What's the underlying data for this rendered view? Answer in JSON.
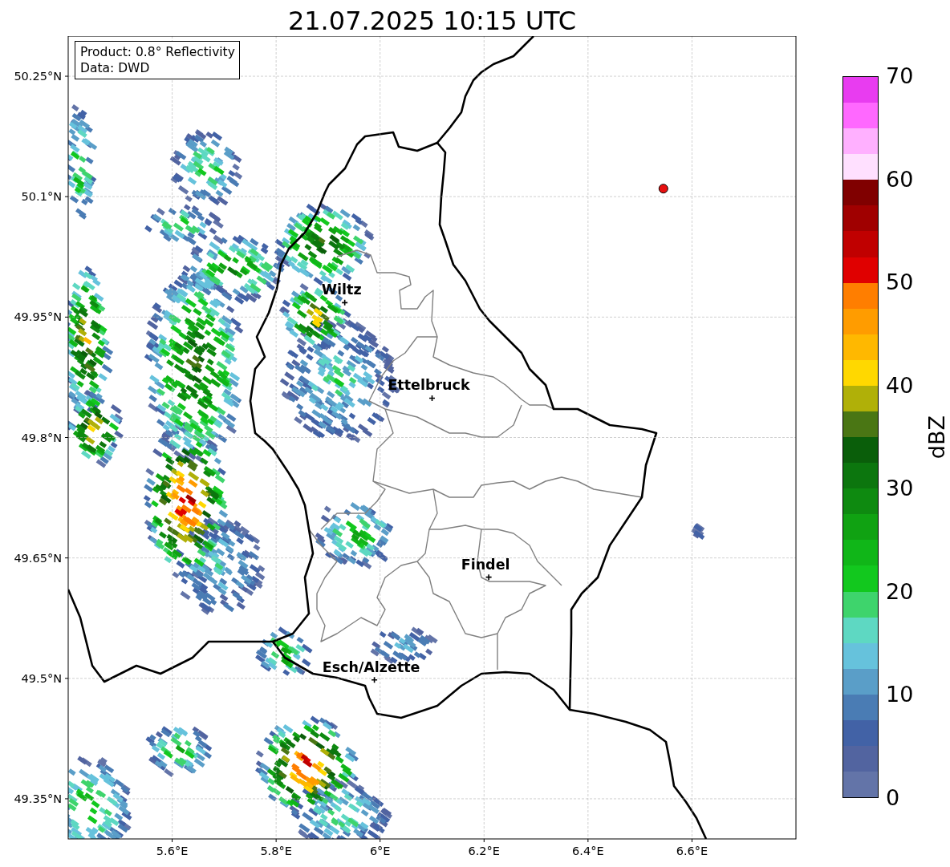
{
  "title": "21.07.2025 10:15 UTC",
  "info_box": [
    "Product: 0.8° Reflectivity",
    "Data: DWD"
  ],
  "map": {
    "chart_data": {
      "type": "scatter",
      "xlim": [
        5.4,
        6.8
      ],
      "ylim": [
        49.3,
        50.3
      ],
      "grid": true,
      "xticks": [
        {
          "value": 5.6,
          "label": "5.6°E"
        },
        {
          "value": 5.8,
          "label": "5.8°E"
        },
        {
          "value": 6.0,
          "label": "6°E"
        },
        {
          "value": 6.2,
          "label": "6.2°E"
        },
        {
          "value": 6.4,
          "label": "6.4°E"
        },
        {
          "value": 6.6,
          "label": "6.6°E"
        }
      ],
      "yticks": [
        {
          "value": 50.25,
          "label": "50.25°N"
        },
        {
          "value": 50.1,
          "label": "50.1°N"
        },
        {
          "value": 49.95,
          "label": "49.95°N"
        },
        {
          "value": 49.8,
          "label": "49.8°N"
        },
        {
          "value": 49.65,
          "label": "49.65°N"
        },
        {
          "value": 49.5,
          "label": "49.5°N"
        },
        {
          "value": 49.35,
          "label": "49.35°N"
        }
      ],
      "series": [
        {
          "color": "#000000",
          "x": [
            5.932,
            6.1,
            6.209,
            5.989
          ],
          "values": [
            49.968,
            49.849,
            49.626,
            49.498
          ]
        },
        {
          "color": "#e81010",
          "x": [
            6.545
          ],
          "values": [
            50.11
          ]
        }
      ],
      "annotations": [
        {
          "x": 5.932,
          "y": 49.968,
          "text": "Wiltz"
        },
        {
          "x": 6.1,
          "y": 49.849,
          "text": "Ettelbruck"
        },
        {
          "x": 6.209,
          "y": 49.626,
          "text": "Findel"
        },
        {
          "x": 5.989,
          "y": 49.498,
          "text": "Esch/Alzette"
        }
      ]
    }
  },
  "colorbar": {
    "label": "dBZ",
    "ticks": [
      "70",
      "60",
      "50",
      "40",
      "30",
      "20",
      "10",
      "0"
    ],
    "bins": [
      {
        "color": "#e83cf0"
      },
      {
        "color": "#ff68ff"
      },
      {
        "color": "#ffb0ff"
      },
      {
        "color": "#ffe0ff"
      },
      {
        "color": "#800000"
      },
      {
        "color": "#a00000"
      },
      {
        "color": "#c00000"
      },
      {
        "color": "#e00000"
      },
      {
        "color": "#ff7e00"
      },
      {
        "color": "#ff9c00"
      },
      {
        "color": "#ffb800"
      },
      {
        "color": "#ffd800"
      },
      {
        "color": "#b0b008"
      },
      {
        "color": "#4a7614"
      },
      {
        "color": "#0a5e0a"
      },
      {
        "color": "#0c760e"
      },
      {
        "color": "#0e8a10"
      },
      {
        "color": "#10a212"
      },
      {
        "color": "#10b618"
      },
      {
        "color": "#12c81e"
      },
      {
        "color": "#3ed46c"
      },
      {
        "color": "#5ed8c2"
      },
      {
        "color": "#66c2dc"
      },
      {
        "color": "#5a9ec8"
      },
      {
        "color": "#4a7cb4"
      },
      {
        "color": "#4262a6"
      },
      {
        "color": "#5264a0"
      },
      {
        "color": "#6374a8"
      }
    ]
  }
}
